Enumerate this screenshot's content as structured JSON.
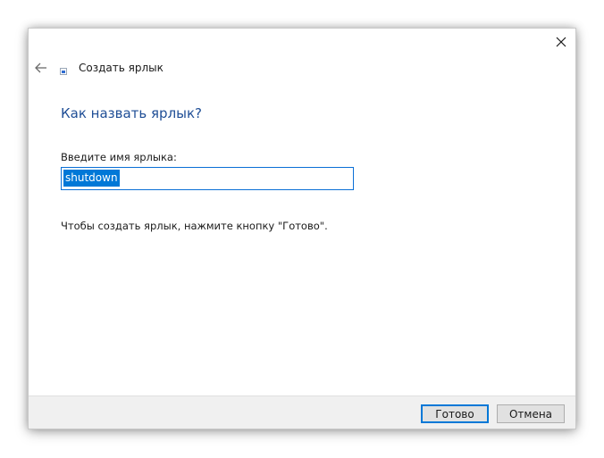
{
  "window": {
    "close_icon": "close-icon",
    "back_icon": "back-arrow-icon",
    "title": "Создать ярлык",
    "title_icon": "shortcut-wizard-icon"
  },
  "content": {
    "heading": "Как назвать ярлык?",
    "name_label": "Введите имя ярлыка:",
    "name_value": "shutdown",
    "hint": "Чтобы создать ярлык, нажмите кнопку \"Готово\"."
  },
  "footer": {
    "ok_label": "Готово",
    "cancel_label": "Отмена"
  },
  "colors": {
    "heading": "#1f4e96",
    "accent": "#0078d7",
    "footer_bg": "#f0f0f0",
    "button_bg": "#e1e1e1"
  }
}
